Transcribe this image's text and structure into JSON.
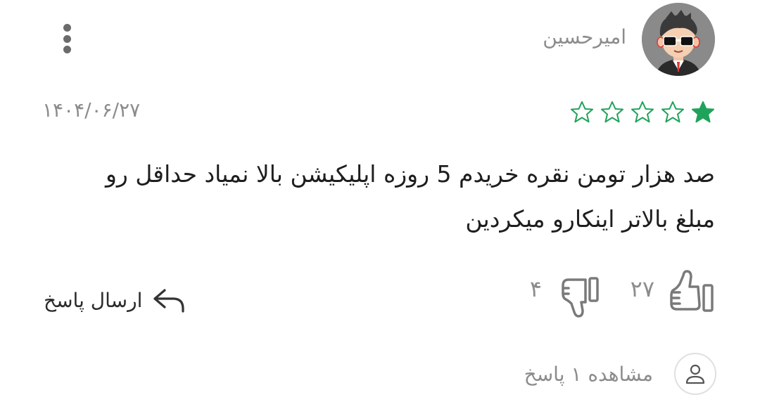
{
  "comment": {
    "author": "امیرحسین",
    "date": "۱۴۰۴/۰۶/۲۷",
    "rating": 1,
    "rating_max": 5,
    "rating_color": "#1fa35a",
    "text": "صد هزار تومن نقره خریدم 5 روزه اپلیکیشن بالا نمیاد حداقل رو مبلغ بالاتر اینکارو میکردین",
    "likes": "۲۷",
    "dislikes": "۴",
    "reply_label": "ارسال پاسخ",
    "view_replies_label": "مشاهده ۱ پاسخ"
  },
  "icons": {
    "menu": "more-vertical-icon",
    "star": "star-icon",
    "like": "thumbs-up-icon",
    "dislike": "thumbs-down-icon",
    "reply": "reply-arrow-icon",
    "user": "user-icon"
  }
}
